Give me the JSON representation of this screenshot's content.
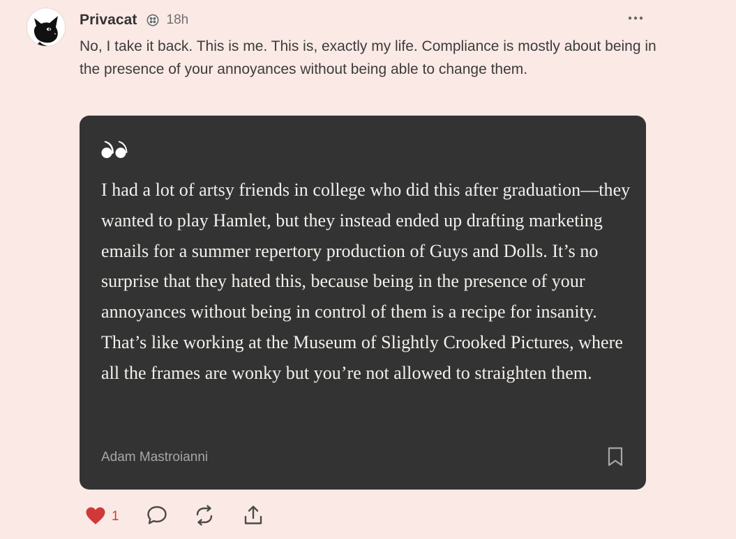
{
  "post": {
    "author": "Privacat",
    "time": "18h",
    "text": "No, I take it back. This is me. This is, exactly my life. Compliance is mostly about being in the presence of your annoyances without being able to change them.",
    "quote": {
      "body": "I had a lot of artsy friends in college who did this after graduation—they wanted to play Hamlet, but they instead ended up drafting marketing emails for a summer repertory production of Guys and Dolls. It’s no surprise that they hated this, because being in the presence of your annoyances without being in control of them is a recipe for insanity. That’s like working at the Museum of Slightly Crooked Pictures, where all the frames are wonky but you’re not allowed to straighten them.",
      "source": "Adam Mastroianni"
    },
    "actions": {
      "like_count": "1"
    }
  },
  "icons": {
    "avatar": "black-cat-avatar",
    "badge": "subscriber-badge-icon",
    "more": "more-options-icon",
    "quote": "quote-mark-icon",
    "bookmark": "bookmark-icon",
    "like": "heart-icon",
    "comment": "comment-icon",
    "restack": "restack-icon",
    "share": "share-icon"
  },
  "colors": {
    "background": "#fbe9e5",
    "card": "#333333",
    "like": "#d0393a"
  }
}
